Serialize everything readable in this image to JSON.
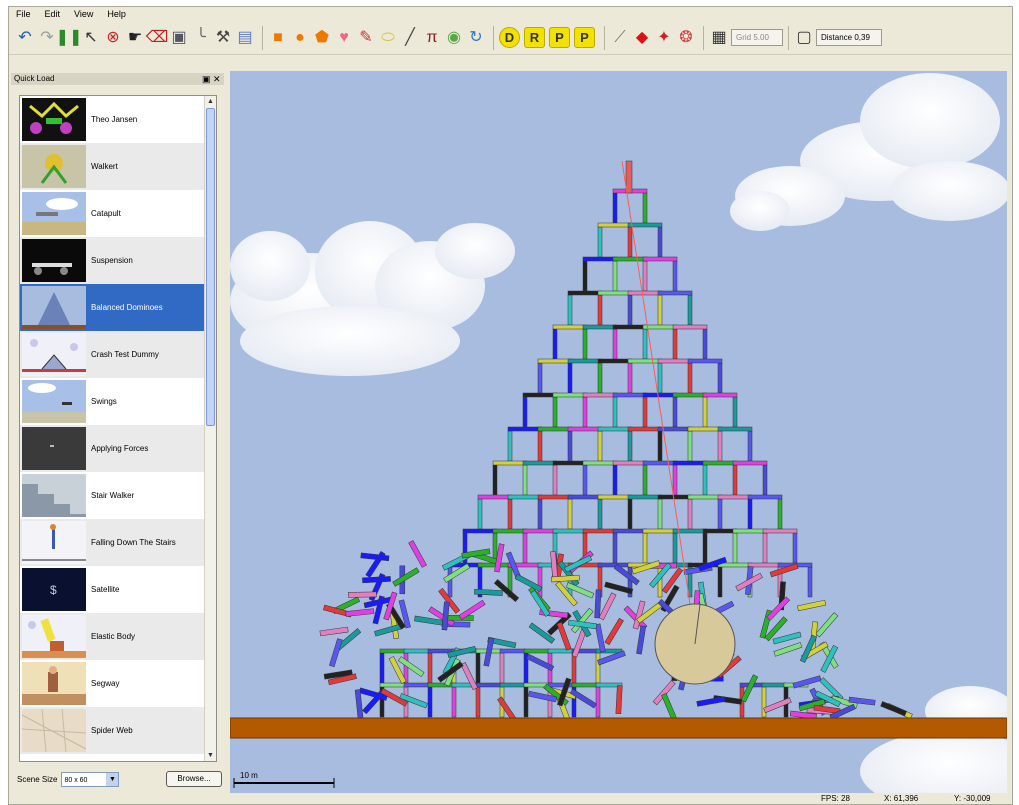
{
  "menu": [
    "File",
    "Edit",
    "View",
    "Help"
  ],
  "toolbar": {
    "tools": [
      {
        "name": "undo-icon",
        "glyph": "↶",
        "color": "#1e5bb8"
      },
      {
        "name": "redo-icon",
        "glyph": "↷",
        "color": "#9a9a9a"
      },
      {
        "name": "pause-icon",
        "glyph": "❚❚",
        "color": "#2c8a2c"
      },
      {
        "name": "pointer-icon",
        "glyph": "↖",
        "color": "#333333"
      },
      {
        "name": "stop-icon",
        "glyph": "⊗",
        "color": "#d32020"
      },
      {
        "name": "drag-hand-icon",
        "glyph": "☛",
        "color": "#222222"
      },
      {
        "name": "erase-icon",
        "glyph": "⌫",
        "color": "#c02020"
      },
      {
        "name": "camera-icon",
        "glyph": "▣",
        "color": "#555566"
      },
      {
        "name": "rope-icon",
        "glyph": "╰",
        "color": "#666666"
      },
      {
        "name": "spring-icon",
        "glyph": "⚒",
        "color": "#444444"
      },
      {
        "name": "board-icon",
        "glyph": "▤",
        "color": "#5b79c9"
      }
    ],
    "shapes": [
      {
        "name": "box-tool-icon",
        "glyph": "■",
        "color": "#f07800"
      },
      {
        "name": "circle-tool-icon",
        "glyph": "●",
        "color": "#f07800"
      },
      {
        "name": "polygon-tool-icon",
        "glyph": "⬟",
        "color": "#f07800"
      },
      {
        "name": "heart-tool-icon",
        "glyph": "♥",
        "color": "#ee6688"
      },
      {
        "name": "pencil-tool-icon",
        "glyph": "✎",
        "color": "#cc3333"
      },
      {
        "name": "capsule-tool-icon",
        "glyph": "⬭",
        "color": "#d8c43a"
      },
      {
        "name": "line-tool-icon",
        "glyph": "╱",
        "color": "#444444"
      },
      {
        "name": "pin-tool-icon",
        "glyph": "π",
        "color": "#882222"
      },
      {
        "name": "wheel-tool-icon",
        "glyph": "◉",
        "color": "#55aa44"
      },
      {
        "name": "rotate-tool-icon",
        "glyph": "↻",
        "color": "#3377cc"
      }
    ],
    "joints": [
      "D",
      "R",
      "P",
      "P"
    ],
    "extras": [
      {
        "name": "ruler-icon",
        "glyph": "⟋",
        "color": "#777777"
      },
      {
        "name": "red-shape-icon",
        "glyph": "◆",
        "color": "#dd1111"
      },
      {
        "name": "red-gear-icon",
        "glyph": "✦",
        "color": "#cc2222"
      },
      {
        "name": "red-dot-icon",
        "glyph": "❂",
        "color": "#cc4444"
      }
    ],
    "grid_label": "Grid 5.00",
    "distance_label": "Distance 0,39"
  },
  "panel": {
    "title": "Quick Load",
    "items": [
      {
        "label": "Theo Jansen"
      },
      {
        "label": "Walkert"
      },
      {
        "label": "Catapult"
      },
      {
        "label": "Suspension"
      },
      {
        "label": "Balanced Dominoes",
        "selected": true
      },
      {
        "label": "Crash Test Dummy"
      },
      {
        "label": "Swings"
      },
      {
        "label": "Applying Forces"
      },
      {
        "label": "Stair Walker"
      },
      {
        "label": "Falling Down The Stairs"
      },
      {
        "label": "Satellite"
      },
      {
        "label": "Elastic Body"
      },
      {
        "label": "Segway"
      },
      {
        "label": "Spider Web"
      }
    ],
    "scene_size_label": "Scene Size",
    "scene_size_value": "80 x 60",
    "browse_label": "Browse..."
  },
  "scene": {
    "scale_label": "10 m",
    "sky_color": "#a8bcdf",
    "ground_color": "#b35a00",
    "wheel_color": "#d8c99a"
  },
  "status": {
    "fps": "FPS: 28",
    "x": "X: 61,396",
    "y": "Y: -30,009"
  }
}
